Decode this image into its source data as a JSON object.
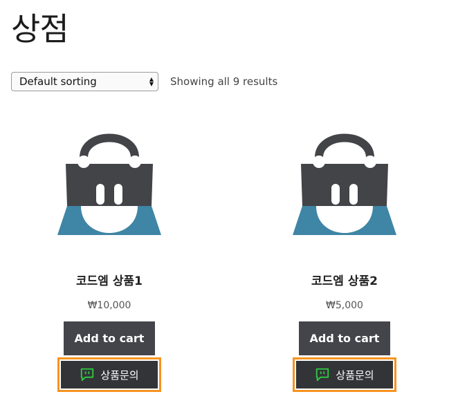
{
  "page": {
    "title": "상점"
  },
  "toolbar": {
    "sort_selected": "Default sorting",
    "result_count": "Showing all 9 results"
  },
  "products": [
    {
      "name": "코드엠 상품1",
      "price": "₩10,000",
      "cart_label": "Add to cart",
      "inquiry_label": "상품문의"
    },
    {
      "name": "코드엠 상품2",
      "price": "₩5,000",
      "cart_label": "Add to cart",
      "inquiry_label": "상품문의"
    }
  ],
  "colors": {
    "bag_dark": "#424448",
    "bag_blue": "#3f85a5",
    "button_bg": "#43454b",
    "inquiry_border": "#f7931e",
    "chat_icon": "#2ecc40"
  },
  "icons": {
    "product_image": "shopping-bag-icon",
    "inquiry": "chat-bubble-icon",
    "sort": "updown-arrows-icon"
  }
}
